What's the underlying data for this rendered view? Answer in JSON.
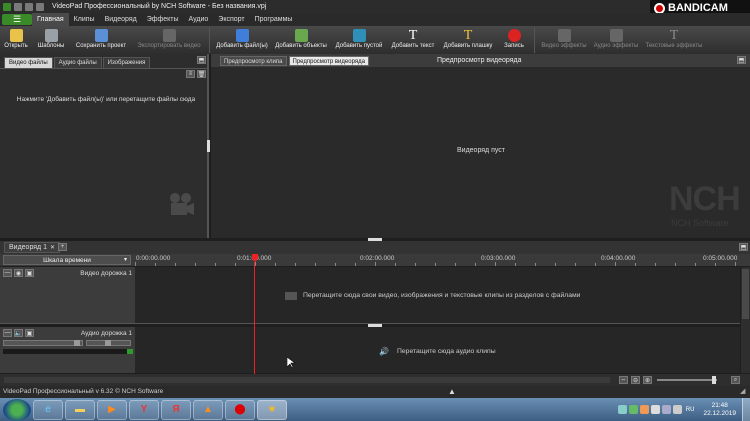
{
  "window": {
    "title": "VideoPad Профессиональный by NCH Software - Без названия.vpj",
    "bandicam": "BANDICAM"
  },
  "menu": {
    "items": [
      "Главная",
      "Клипы",
      "Видеоряд",
      "Эффекты",
      "Аудио",
      "Экспорт",
      "Программы"
    ]
  },
  "toolbar": {
    "open": "Открыть",
    "templates": "Шаблоны",
    "save_project": "Сохранить проект",
    "export_video": "Экспортировать видео",
    "add_files": "Добавить файл(ы)",
    "add_objects": "Добавить объекты",
    "add_blank": "Добавить пустой",
    "add_text": "Добавить текст",
    "add_plate": "Добавить плашку",
    "record": "Запись",
    "video_effects": "Видео эффекты",
    "audio_effects": "Аудио эффекты",
    "text_effects": "Текстовые эффекты"
  },
  "library": {
    "tabs": [
      "Видео файлы",
      "Аудио файлы",
      "Изображения"
    ],
    "hint": "Нажмите 'Добавить файл(ы)' или перетащите файлы сюда"
  },
  "preview": {
    "tabs": [
      "Предпросмотр клипа",
      "Предпросмотр видеоряда"
    ],
    "heading": "Предпросмотр видеоряда",
    "empty": "Видеоряд пуст",
    "watermark_logo": "NCH",
    "watermark_text": "NCH Software"
  },
  "timeline": {
    "tab": "Видеоряд 1",
    "tab_close": "✕",
    "tab_add": "+",
    "scale_label": "Шкала времени",
    "ticks": [
      "0:00:00.000",
      "0:01:00.000",
      "0:02:00.000",
      "0:03:00.000",
      "0:04:00.000",
      "0:05:00.000"
    ],
    "video_track": "Видео дорожка 1",
    "audio_track": "Аудио дорожка 1",
    "video_hint": "Перетащите сюда свои видео, изображения и текстовые клипы из разделов с файлами",
    "audio_hint": "Перетащите сюда аудио клипы"
  },
  "status": {
    "version": "VideoPad Профессиональный v 6.32 © NCH Software"
  },
  "taskbar": {
    "time": "21:48",
    "date": "22.12.2019",
    "lang": "RU"
  }
}
